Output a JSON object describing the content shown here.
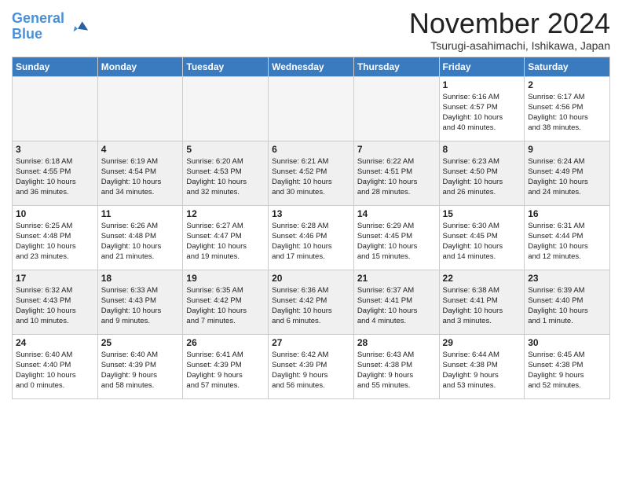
{
  "header": {
    "logo_line1": "General",
    "logo_line2": "Blue",
    "month_title": "November 2024",
    "location": "Tsurugi-asahimachi, Ishikawa, Japan"
  },
  "weekdays": [
    "Sunday",
    "Monday",
    "Tuesday",
    "Wednesday",
    "Thursday",
    "Friday",
    "Saturday"
  ],
  "weeks": [
    [
      {
        "day": "",
        "info": "",
        "empty": true
      },
      {
        "day": "",
        "info": "",
        "empty": true
      },
      {
        "day": "",
        "info": "",
        "empty": true
      },
      {
        "day": "",
        "info": "",
        "empty": true
      },
      {
        "day": "",
        "info": "",
        "empty": true
      },
      {
        "day": "1",
        "info": "Sunrise: 6:16 AM\nSunset: 4:57 PM\nDaylight: 10 hours\nand 40 minutes."
      },
      {
        "day": "2",
        "info": "Sunrise: 6:17 AM\nSunset: 4:56 PM\nDaylight: 10 hours\nand 38 minutes."
      }
    ],
    [
      {
        "day": "3",
        "info": "Sunrise: 6:18 AM\nSunset: 4:55 PM\nDaylight: 10 hours\nand 36 minutes."
      },
      {
        "day": "4",
        "info": "Sunrise: 6:19 AM\nSunset: 4:54 PM\nDaylight: 10 hours\nand 34 minutes."
      },
      {
        "day": "5",
        "info": "Sunrise: 6:20 AM\nSunset: 4:53 PM\nDaylight: 10 hours\nand 32 minutes."
      },
      {
        "day": "6",
        "info": "Sunrise: 6:21 AM\nSunset: 4:52 PM\nDaylight: 10 hours\nand 30 minutes."
      },
      {
        "day": "7",
        "info": "Sunrise: 6:22 AM\nSunset: 4:51 PM\nDaylight: 10 hours\nand 28 minutes."
      },
      {
        "day": "8",
        "info": "Sunrise: 6:23 AM\nSunset: 4:50 PM\nDaylight: 10 hours\nand 26 minutes."
      },
      {
        "day": "9",
        "info": "Sunrise: 6:24 AM\nSunset: 4:49 PM\nDaylight: 10 hours\nand 24 minutes."
      }
    ],
    [
      {
        "day": "10",
        "info": "Sunrise: 6:25 AM\nSunset: 4:48 PM\nDaylight: 10 hours\nand 23 minutes."
      },
      {
        "day": "11",
        "info": "Sunrise: 6:26 AM\nSunset: 4:48 PM\nDaylight: 10 hours\nand 21 minutes."
      },
      {
        "day": "12",
        "info": "Sunrise: 6:27 AM\nSunset: 4:47 PM\nDaylight: 10 hours\nand 19 minutes."
      },
      {
        "day": "13",
        "info": "Sunrise: 6:28 AM\nSunset: 4:46 PM\nDaylight: 10 hours\nand 17 minutes."
      },
      {
        "day": "14",
        "info": "Sunrise: 6:29 AM\nSunset: 4:45 PM\nDaylight: 10 hours\nand 15 minutes."
      },
      {
        "day": "15",
        "info": "Sunrise: 6:30 AM\nSunset: 4:45 PM\nDaylight: 10 hours\nand 14 minutes."
      },
      {
        "day": "16",
        "info": "Sunrise: 6:31 AM\nSunset: 4:44 PM\nDaylight: 10 hours\nand 12 minutes."
      }
    ],
    [
      {
        "day": "17",
        "info": "Sunrise: 6:32 AM\nSunset: 4:43 PM\nDaylight: 10 hours\nand 10 minutes."
      },
      {
        "day": "18",
        "info": "Sunrise: 6:33 AM\nSunset: 4:43 PM\nDaylight: 10 hours\nand 9 minutes."
      },
      {
        "day": "19",
        "info": "Sunrise: 6:35 AM\nSunset: 4:42 PM\nDaylight: 10 hours\nand 7 minutes."
      },
      {
        "day": "20",
        "info": "Sunrise: 6:36 AM\nSunset: 4:42 PM\nDaylight: 10 hours\nand 6 minutes."
      },
      {
        "day": "21",
        "info": "Sunrise: 6:37 AM\nSunset: 4:41 PM\nDaylight: 10 hours\nand 4 minutes."
      },
      {
        "day": "22",
        "info": "Sunrise: 6:38 AM\nSunset: 4:41 PM\nDaylight: 10 hours\nand 3 minutes."
      },
      {
        "day": "23",
        "info": "Sunrise: 6:39 AM\nSunset: 4:40 PM\nDaylight: 10 hours\nand 1 minute."
      }
    ],
    [
      {
        "day": "24",
        "info": "Sunrise: 6:40 AM\nSunset: 4:40 PM\nDaylight: 10 hours\nand 0 minutes."
      },
      {
        "day": "25",
        "info": "Sunrise: 6:40 AM\nSunset: 4:39 PM\nDaylight: 9 hours\nand 58 minutes."
      },
      {
        "day": "26",
        "info": "Sunrise: 6:41 AM\nSunset: 4:39 PM\nDaylight: 9 hours\nand 57 minutes."
      },
      {
        "day": "27",
        "info": "Sunrise: 6:42 AM\nSunset: 4:39 PM\nDaylight: 9 hours\nand 56 minutes."
      },
      {
        "day": "28",
        "info": "Sunrise: 6:43 AM\nSunset: 4:38 PM\nDaylight: 9 hours\nand 55 minutes."
      },
      {
        "day": "29",
        "info": "Sunrise: 6:44 AM\nSunset: 4:38 PM\nDaylight: 9 hours\nand 53 minutes."
      },
      {
        "day": "30",
        "info": "Sunrise: 6:45 AM\nSunset: 4:38 PM\nDaylight: 9 hours\nand 52 minutes."
      }
    ]
  ]
}
